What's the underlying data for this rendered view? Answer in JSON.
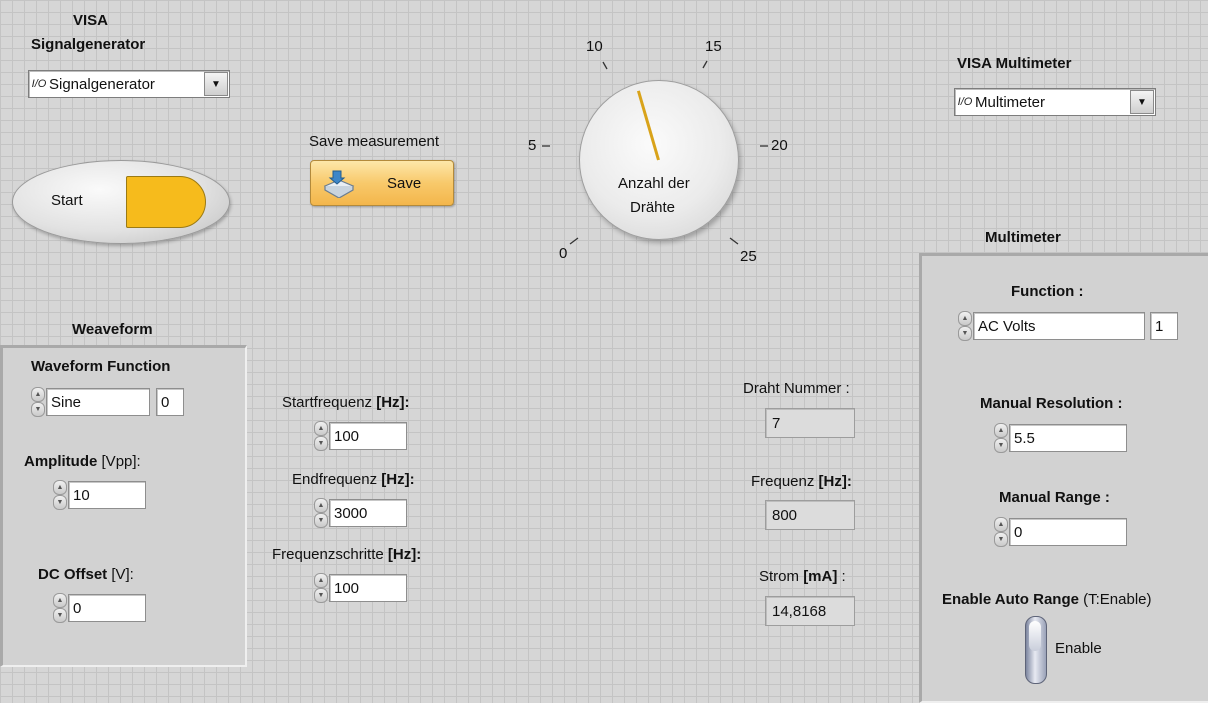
{
  "visa_signal": {
    "label_line1": "VISA",
    "label_line2": "Signalgenerator",
    "io_glyph": "I/O",
    "value": "Signalgenerator",
    "dropdown_icon": "chevron-down-icon"
  },
  "visa_multimeter": {
    "label": "VISA Multimeter",
    "io_glyph": "I/O",
    "value": "Multimeter",
    "dropdown_icon": "chevron-down-icon"
  },
  "start_button": {
    "label": "Start",
    "led_color": "#f6bb1c"
  },
  "save": {
    "caption": "Save measurement",
    "button_label": "Save",
    "icon": "disk-save-icon"
  },
  "knob": {
    "label_line1": "Anzahl der",
    "label_line2": "Drähte",
    "ticks": [
      "0",
      "5",
      "10",
      "15",
      "20",
      "25"
    ],
    "value": 11,
    "needle_color": "#d9a31a"
  },
  "waveform": {
    "title": "Weaveform",
    "function_label": "Waveform Function",
    "function_value": "Sine",
    "function_index": "0",
    "amplitude_label": "Amplitude",
    "amplitude_unit": "[Vpp]:",
    "amplitude_value": "10",
    "dc_label": "DC Offset",
    "dc_unit": "[V]:",
    "dc_value": "0"
  },
  "freq": {
    "start_label": "Startfrequenz",
    "start_unit": "[Hz]:",
    "start_value": "100",
    "end_label": "Endfrequenz",
    "end_unit": "[Hz]:",
    "end_value": "3000",
    "step_label": "Frequenzschritte",
    "step_unit": "[Hz]:",
    "step_value": "100"
  },
  "readout": {
    "draht_label": "Draht Nummer :",
    "draht_value": "7",
    "frequenz_label": "Frequenz",
    "frequenz_unit": "[Hz]:",
    "frequenz_value": "800",
    "strom_label": "Strom",
    "strom_unit": "[mA]",
    "strom_colon": " :",
    "strom_value": "14,8168"
  },
  "multimeter": {
    "title": "Multimeter",
    "function_label": "Function :",
    "function_value": "AC Volts",
    "function_index": "1",
    "resolution_label": "Manual Resolution :",
    "resolution_value": "5.5",
    "range_label": "Manual Range :",
    "range_value": "0",
    "autorange_label": "Enable Auto Range",
    "autorange_hint": "(T:Enable)",
    "toggle_label": "Enable"
  }
}
